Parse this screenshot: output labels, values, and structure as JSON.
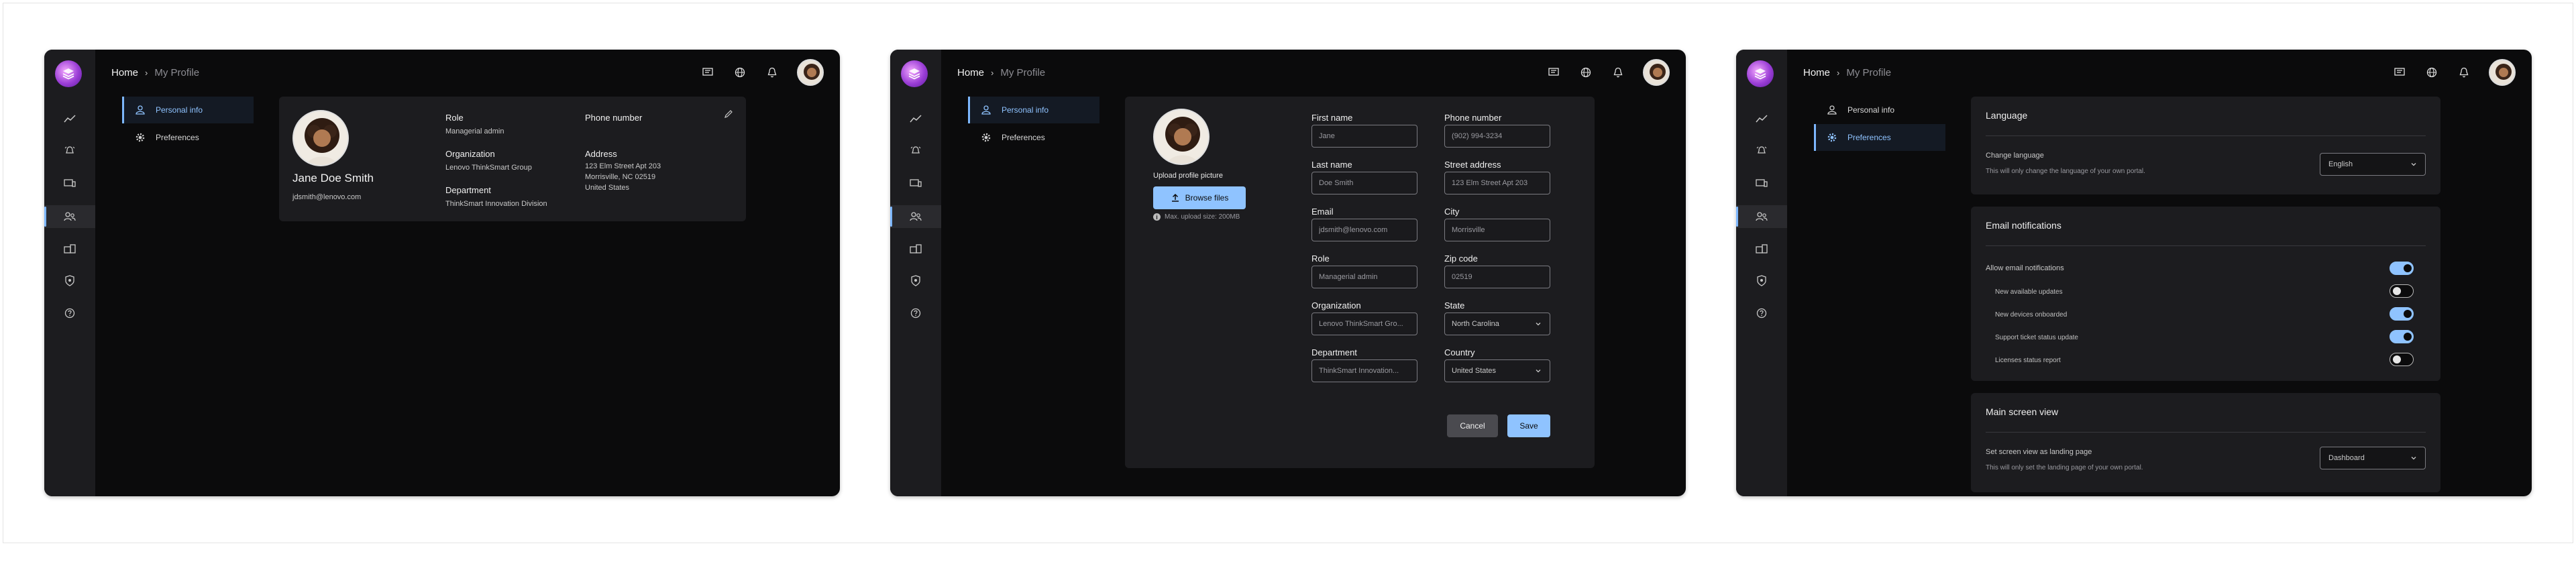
{
  "breadcrumb": {
    "home": "Home",
    "sep": "›",
    "current": "My Profile"
  },
  "subnav": {
    "personal_info": "Personal info",
    "preferences": "Preferences"
  },
  "profile": {
    "name": "Jane Doe Smith",
    "email": "jdsmith@lenovo.com",
    "role_label": "Role",
    "role": "Managerial admin",
    "org_label": "Organization",
    "org": "Lenovo ThinkSmart Group",
    "dept_label": "Department",
    "dept": "ThinkSmart Innovation Division",
    "phone_label": "Phone number",
    "address_label": "Address",
    "address_line1": "123 Elm Street Apt 203",
    "address_line2": "Morrisville, NC 02519",
    "address_line3": "United States"
  },
  "edit": {
    "upload_label": "Upload profile picture",
    "browse_label": "Browse files",
    "max_upload": "Max. upload size: 200MB",
    "first_name_label": "First name",
    "first_name": "Jane",
    "last_name_label": "Last name",
    "last_name": "Doe Smith",
    "email_label": "Email",
    "email": "jdsmith@lenovo.com",
    "role_label": "Role",
    "role": "Managerial admin",
    "org_label": "Organization",
    "org": "Lenovo ThinkSmart Gro...",
    "dept_label": "Department",
    "dept": "ThinkSmart Innovation...",
    "phone_label": "Phone number",
    "phone": "(902) 994-3234",
    "street_label": "Street address",
    "street": "123 Elm Street Apt 203",
    "city_label": "City",
    "city": "Morrisville",
    "zip_label": "Zip code",
    "zip": "02519",
    "state_label": "State",
    "state": "North Carolina",
    "country_label": "Country",
    "country": "United States",
    "cancel": "Cancel",
    "save": "Save"
  },
  "prefs": {
    "language_title": "Language",
    "change_language": "Change language",
    "change_language_desc": "This will only change the language of your own portal.",
    "language_value": "English",
    "email_title": "Email notifications",
    "allow_email": "Allow email notifications",
    "notifications": [
      {
        "label": "New available updates",
        "on": false
      },
      {
        "label": "New devices onboarded",
        "on": true
      },
      {
        "label": "Support ticket status update",
        "on": true
      },
      {
        "label": "Licenses status report",
        "on": false
      }
    ],
    "allow_email_on": true,
    "main_title": "Main screen view",
    "set_landing": "Set screen view as landing page",
    "set_landing_desc": "This will only set the landing page of your own portal.",
    "landing_value": "Dashboard"
  },
  "colors": {
    "accent": "#8fc3ff",
    "rail": "#1c1c1f",
    "background": "#0b0b0c"
  }
}
